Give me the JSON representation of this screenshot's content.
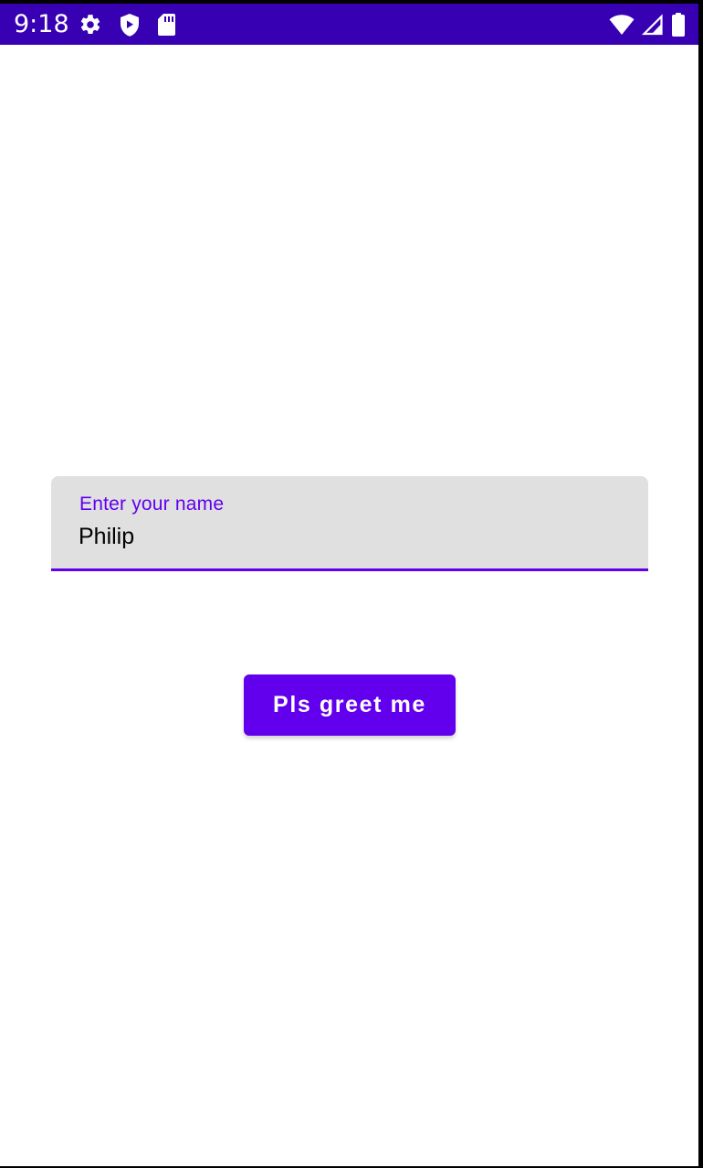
{
  "status_bar": {
    "time": "9:18",
    "background": "#3700b3",
    "left_icons": [
      "gear-icon",
      "shield-play-icon",
      "sd-card-icon"
    ],
    "right_icons": [
      "wifi-icon",
      "signal-icon",
      "battery-icon"
    ]
  },
  "form": {
    "name_label": "Enter your name",
    "name_value": "Philip",
    "accent_color": "#6200ee",
    "field_background": "#e0e0e0"
  },
  "actions": {
    "greet_label": "Pls greet me"
  }
}
